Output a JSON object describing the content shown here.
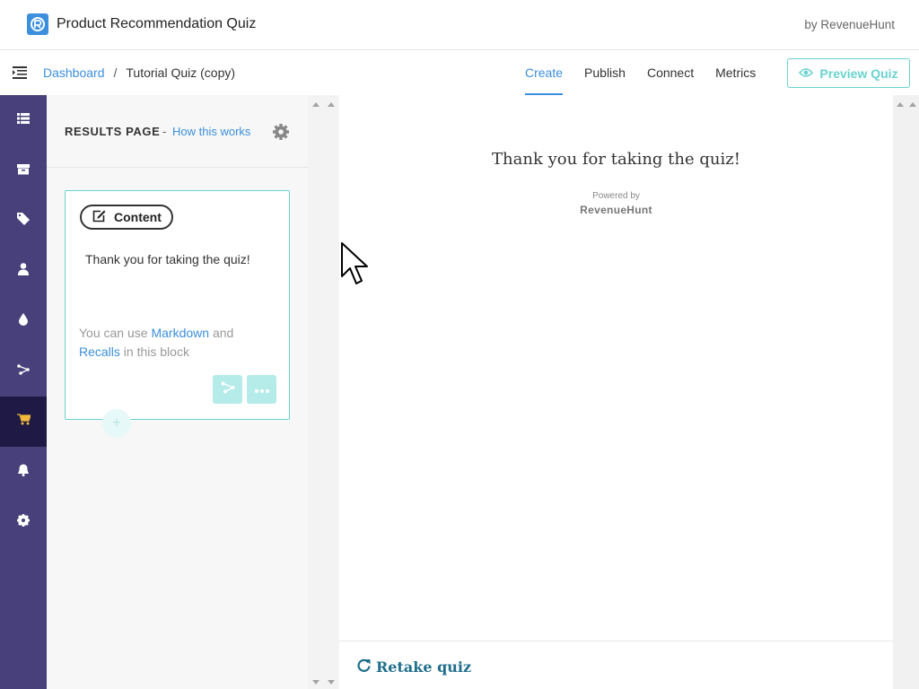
{
  "header": {
    "app_title": "Product Recommendation Quiz",
    "by_label": "by RevenueHunt"
  },
  "nav": {
    "breadcrumb_root": "Dashboard",
    "breadcrumb_separator": "/",
    "breadcrumb_current": "Tutorial Quiz (copy)",
    "tabs": [
      {
        "label": "Create",
        "active": true
      },
      {
        "label": "Publish",
        "active": false
      },
      {
        "label": "Connect",
        "active": false
      },
      {
        "label": "Metrics",
        "active": false
      }
    ],
    "preview_button": "Preview Quiz"
  },
  "sidebar": {
    "items": [
      {
        "icon": "list-icon"
      },
      {
        "icon": "box-icon"
      },
      {
        "icon": "tag-icon"
      },
      {
        "icon": "user-icon"
      },
      {
        "icon": "drop-icon"
      },
      {
        "icon": "flow-icon"
      },
      {
        "icon": "cart-icon",
        "active": true
      },
      {
        "icon": "bell-icon"
      },
      {
        "icon": "gear-icon"
      }
    ]
  },
  "editor": {
    "section_title": "RESULTS PAGE",
    "section_dash": "-",
    "how_link": "How this works",
    "card": {
      "pill_label": "Content",
      "text": "Thank you for taking the quiz!",
      "hint_prefix": "You can use",
      "hint_link1": "Markdown",
      "hint_and": "and",
      "hint_link2": "Recalls",
      "hint_suffix": "in this block"
    }
  },
  "preview": {
    "thanks_text": "Thank you for taking the quiz!",
    "powered_by": "Powered by",
    "powered_brand": "RevenueHunt",
    "retake_label": "Retake quiz"
  },
  "colors": {
    "accent_blue": "#3b8fdc",
    "teal": "#6ad3cf",
    "sidebar_bg": "#47407a",
    "sidebar_active": "#1f1a45",
    "cart_yellow": "#f0b93a"
  }
}
